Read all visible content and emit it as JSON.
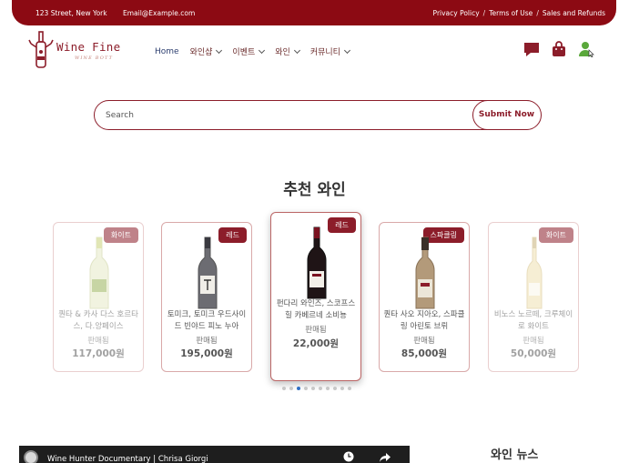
{
  "topbar": {
    "address": "123 Street, New York",
    "email": "Email@Example.com",
    "links": [
      "Privacy Policy",
      "Terms of Use",
      "Sales and Refunds"
    ],
    "separator": "/"
  },
  "logo": {
    "name": "Wine Fine",
    "tagline": "WINE BOTT"
  },
  "nav": [
    {
      "label": "Home",
      "dropdown": false
    },
    {
      "label": "와인샵",
      "dropdown": true
    },
    {
      "label": "이벤트",
      "dropdown": true
    },
    {
      "label": "와인",
      "dropdown": true
    },
    {
      "label": "커뮤니티",
      "dropdown": true
    }
  ],
  "header_icons": [
    "chat-icon",
    "shopping-bag-icon",
    "user-icon"
  ],
  "search": {
    "placeholder": "Search",
    "button": "Submit Now"
  },
  "section_title": "추천 와인",
  "wines": [
    {
      "badge": "화이트",
      "name": "퀀타 & 카사 다스 호르타스, 다.앙페이스",
      "sales_label": "판매됨",
      "price": "117,000원",
      "bottle": "white"
    },
    {
      "badge": "레드",
      "name": "토미크, 토미크 우드사이드 빈야드 피노 누아",
      "sales_label": "판매됨",
      "price": "195,000원",
      "bottle": "grey"
    },
    {
      "badge": "레드",
      "name": "펀다리 와인즈, 스코프스 힐 카베르네 소비뇽",
      "sales_label": "판매됨",
      "price": "22,000원",
      "bottle": "red"
    },
    {
      "badge": "스파클링",
      "name": "퀀타 사오 지아오, 스파클링 아린토 브뤼",
      "sales_label": "판매됨",
      "price": "85,000원",
      "bottle": "sparkling"
    },
    {
      "badge": "화이트",
      "name": "비노스 노르떼, 크루체이로 화이트",
      "sales_label": "판매됨",
      "price": "50,000원",
      "bottle": "white2"
    }
  ],
  "carousel": {
    "dot_count": 10,
    "active_index": 2
  },
  "video": {
    "title": "Wine Hunter Documentary | Chrisa Giorgi"
  },
  "news_title": "와인 뉴스",
  "colors": {
    "brand": "#8c0a13",
    "accent": "#8c1d2a",
    "badge": "#8c1d2a",
    "user_icon": "#5aa83b"
  }
}
